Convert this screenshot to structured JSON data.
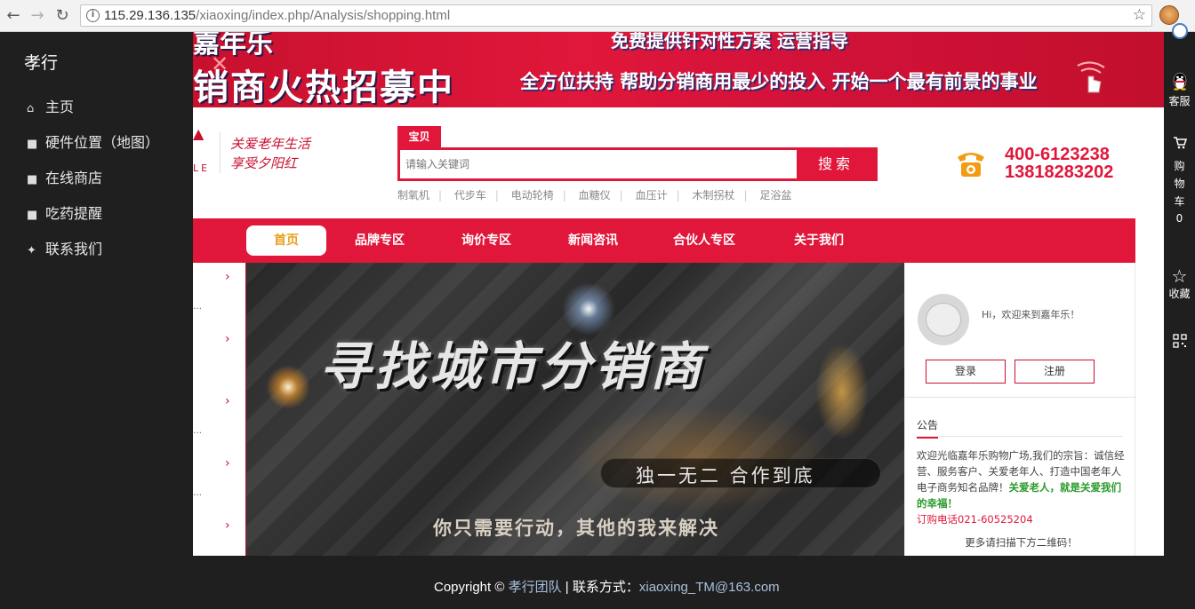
{
  "browser": {
    "url_host": "115.29.136.135",
    "url_path": "/xiaoxing/index.php/Analysis/shopping.html"
  },
  "sidebar": {
    "brand": "孝行",
    "items": [
      {
        "label": "主页",
        "icon": "home-icon"
      },
      {
        "label": "硬件位置（地图）",
        "icon": "folder-icon"
      },
      {
        "label": "在线商店",
        "icon": "folder-icon"
      },
      {
        "label": "吃药提醒",
        "icon": "folder-icon"
      },
      {
        "label": "联系我们",
        "icon": "twitter-icon"
      }
    ]
  },
  "right_toolbar": {
    "service_label": "客服",
    "cart_label": "购物车",
    "cart_count": "0",
    "favorite_label": "收藏"
  },
  "banner": {
    "top_left": "嘉年乐",
    "headline": "销商火热招募中",
    "top_right": "免费提供针对性方案 运营指导",
    "slogan": "全方位扶持 帮助分销商用最少的投入 开始一个最有前景的事业"
  },
  "header": {
    "tagline_1": "关爱老年生活",
    "tagline_2": "享受夕阳红",
    "search_tab": "宝贝",
    "search_placeholder": "请输入关键词",
    "search_button": "搜索",
    "hot_keywords": [
      "制氧机",
      "代步车",
      "电动轮椅",
      "血糖仪",
      "血压计",
      "木制拐杖",
      "足浴盆"
    ],
    "phone_1": "400-6123238",
    "phone_2": "13818283202"
  },
  "nav": {
    "items": [
      "首页",
      "品牌专区",
      "询价专区",
      "新闻咨讯",
      "合伙人专区",
      "关于我们"
    ],
    "active": "首页"
  },
  "hero": {
    "title": "寻找城市分销商",
    "pill": "独一无二  合作到底",
    "subtitle": "你只需要行动，其他的我来解决"
  },
  "user_panel": {
    "welcome": "Hi，欢迎来到嘉年乐！",
    "login": "登录",
    "register": "注册",
    "notice_title": "公告",
    "notice_text": "欢迎光临嘉年乐购物广场,我们的宗旨：诚信经营、服务客户、关爱老年人、打造中国老年人电子商务知名品牌！",
    "notice_highlight": "关爱老人，就是关爱我们的幸福！",
    "notice_phone": "订购电话021-60525204",
    "notice_more": "更多请扫描下方二维码！"
  },
  "footer": {
    "copyright_prefix": "Copyright ©",
    "team": "孝行团队",
    "contact_label": "| 联系方式：",
    "email": "xiaoxing_TM@163.com"
  },
  "colors": {
    "accent_red": "#e0173a",
    "sidebar_bg": "#1f1f1f",
    "active_nav_text": "#e8a020"
  }
}
